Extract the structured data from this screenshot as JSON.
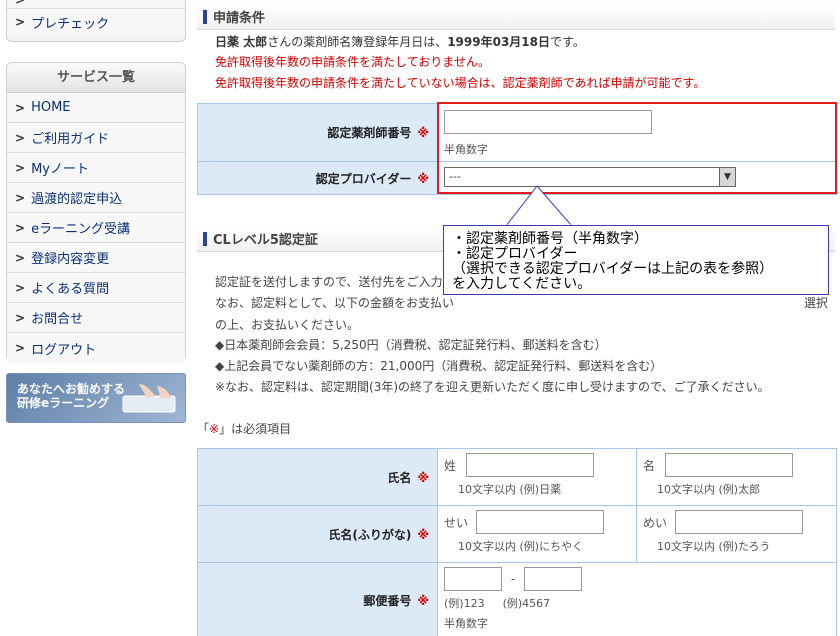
{
  "sidebar_top": {
    "items": [
      {
        "label": "プレチェック"
      }
    ]
  },
  "sidebar": {
    "title": "サービス一覧",
    "items": [
      {
        "label": "HOME"
      },
      {
        "label": "ご利用ガイド"
      },
      {
        "label": "Myノート"
      },
      {
        "label": "過渡的認定申込"
      },
      {
        "label": "eラーニング受講"
      },
      {
        "label": "登録内容変更"
      },
      {
        "label": "よくある質問"
      },
      {
        "label": "お問合せ"
      },
      {
        "label": "ログアウト"
      }
    ]
  },
  "banner": {
    "line1": "あなたへお勧めする",
    "line2": "研修eラーニング"
  },
  "conditions": {
    "heading": "申請条件",
    "name": "日薬 太郎",
    "date_sentence_suffix": "さんの薬剤師名簿登録年月日は、",
    "date": "1999年03月18日",
    "date_end": "です。",
    "warning1": "免許取得後年数の申請条件を満たしておりません。",
    "warning2": "免許取得後年数の申請条件を満たしていない場合は、認定薬剤師であれば申請が可能です。"
  },
  "cert_form": {
    "number_label": "認定薬剤師番号",
    "number_hint": "半角数字",
    "provider_label": "認定プロバイダー",
    "provider_value": "---",
    "required_mark": "※"
  },
  "tooltip": {
    "line1": "・認定薬剤師番号（半角数字）",
    "line2": "・認定プロバイダー",
    "line3": "（選択できる認定プロバイダーは上記の表を参照）",
    "line4": "を入力してください。"
  },
  "cl5": {
    "heading": "CLレベル5認定証",
    "text1": "認定証を送付しますので、送付先をご入力",
    "text2a": "なお、認定料として、以下の金額をお支払い",
    "text2b": "選択",
    "text3": "の上、お支払いください。",
    "text4": "◆日本薬剤師会会員：5,250円（消費税、認定証発行料、郵送料を含む）",
    "text5": "◆上記会員でない薬剤師の方：21,000円（消費税、認定証発行料、郵送料を含む）",
    "text6": "※なお、認定料は、認定期間(3年)の終了を迎え更新いただく度に申し受けますので、ご了承ください。"
  },
  "required_note": {
    "open": "「",
    "mark": "※",
    "close": "」は必須項目"
  },
  "address_form": {
    "name_label": "氏名",
    "sei": "姓",
    "sei_hint": "10文字以内 (例)日薬",
    "mei": "名",
    "mei_hint": "10文字以内 (例)太郎",
    "kana_label": "氏名(ふりがな)",
    "sei_kana": "せい",
    "sei_kana_hint": "10文字以内 (例)にちやく",
    "mei_kana": "めい",
    "mei_kana_hint": "10文字以内 (例)たろう",
    "zip_label": "郵便番号",
    "zip_sep": "-",
    "zip_hint1": "(例)123",
    "zip_hint2": "(例)4567",
    "zip_hint3": "半角数字"
  }
}
